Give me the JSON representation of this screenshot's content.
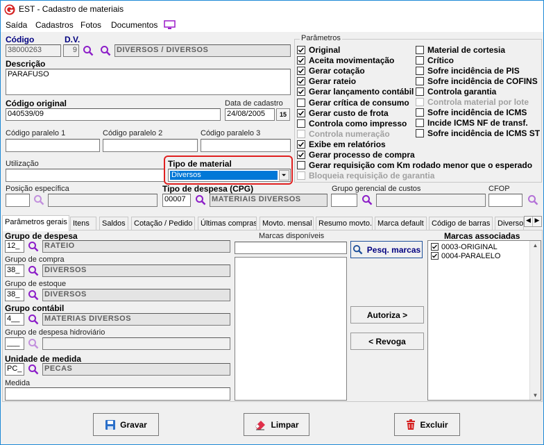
{
  "window": {
    "title": "EST - Cadastro de materiais"
  },
  "menu": {
    "items": [
      "Saída",
      "Cadastros",
      "Fotos",
      "Documentos"
    ]
  },
  "header": {
    "codigo_label": "Código",
    "codigo_value": "38000263",
    "dv_label": "D.V.",
    "dv_value": "9",
    "grupo_desc": "DIVERSOS / DIVERSOS",
    "descricao_label": "Descrição",
    "descricao_value": "PARAFUSO",
    "cod_original_label": "Código original",
    "cod_original_value": "040539/09",
    "data_cadastro_label": "Data de cadastro",
    "data_cadastro_value": "24/08/2005",
    "calendar_label": "15",
    "cod_paralelo1_label": "Código paralelo 1",
    "cod_paralelo2_label": "Código paralelo 2",
    "cod_paralelo3_label": "Código paralelo 3",
    "utilizacao_label": "Utilização",
    "tipo_material_label": "Tipo de material",
    "tipo_material_value": "Diversos",
    "posicao_label": "Posição específica",
    "tipo_despesa_label": "Tipo de despesa (CPG)",
    "tipo_despesa_code": "00007",
    "tipo_despesa_desc": "MATERIAIS DIVERSOS",
    "grupo_gerencial_label": "Grupo gerencial de custos",
    "cfop_label": "CFOP"
  },
  "parametros": {
    "title": "Parâmetros",
    "left": [
      {
        "label": "Original",
        "checked": true,
        "disabled": false
      },
      {
        "label": "Aceita movimentação",
        "checked": true,
        "disabled": false
      },
      {
        "label": "Gerar cotação",
        "checked": true,
        "disabled": false
      },
      {
        "label": "Gerar rateio",
        "checked": true,
        "disabled": false
      },
      {
        "label": "Gerar lançamento contábil",
        "checked": true,
        "disabled": false
      },
      {
        "label": "Gerar crítica de consumo",
        "checked": false,
        "disabled": false
      },
      {
        "label": "Gerar custo de frota",
        "checked": true,
        "disabled": false
      },
      {
        "label": "Controla como impresso",
        "checked": false,
        "disabled": false
      },
      {
        "label": "Controla numeração",
        "checked": false,
        "disabled": true
      },
      {
        "label": "Exibe em relatórios",
        "checked": true,
        "disabled": false
      },
      {
        "label": "Gerar processo de compra",
        "checked": true,
        "disabled": false
      },
      {
        "label": "Gerar requisição com Km rodado menor que o esperado",
        "checked": false,
        "disabled": false
      },
      {
        "label": "Bloqueia requisição de garantia",
        "checked": false,
        "disabled": true
      }
    ],
    "right": [
      {
        "label": "Material de cortesia",
        "checked": false,
        "disabled": false
      },
      {
        "label": "Crítico",
        "checked": false,
        "disabled": false
      },
      {
        "label": "Sofre incidência de PIS",
        "checked": false,
        "disabled": false
      },
      {
        "label": "Sofre incidência de COFINS",
        "checked": false,
        "disabled": false
      },
      {
        "label": "Controla garantia",
        "checked": false,
        "disabled": false
      },
      {
        "label": "Controla material por lote",
        "checked": false,
        "disabled": true
      },
      {
        "label": "Sofre incidência de ICMS",
        "checked": false,
        "disabled": false
      },
      {
        "label": "Incide ICMS NF de transf.",
        "checked": false,
        "disabled": false
      },
      {
        "label": "Sofre incidência de ICMS ST",
        "checked": false,
        "disabled": false
      }
    ]
  },
  "tabs": [
    "Parâmetros gerais",
    "Itens",
    "Saldos",
    "Cotação / Pedido",
    "Últimas compras",
    "Movto. mensal",
    "Resumo movto.",
    "Marca default",
    "Código de barras",
    "Diversos"
  ],
  "geral": {
    "grupo_despesa_label": "Grupo de despesa",
    "grupo_despesa_code": "12_",
    "grupo_despesa_desc": "RATEIO",
    "grupo_compra_label": "Grupo de compra",
    "grupo_compra_code": "38_",
    "grupo_compra_desc": "DIVERSOS",
    "grupo_estoque_label": "Grupo de estoque",
    "grupo_estoque_code": "38_",
    "grupo_estoque_desc": "DIVERSOS",
    "grupo_contabil_label": "Grupo contábil",
    "grupo_contabil_code": "4__",
    "grupo_contabil_desc": "MATERIAS DIVERSOS",
    "grupo_hidro_label": "Grupo de despesa hidroviário",
    "grupo_hidro_code": "___",
    "unidade_label": "Unidade de medida",
    "unidade_code": "PC_",
    "unidade_desc": "PECAS",
    "medida_label": "Medida",
    "marcas_disp_label": "Marcas disponíveis",
    "pesq_marcas": "Pesq. marcas",
    "autoriza": "Autoriza >",
    "revoga": "< Revoga",
    "marcas_assoc_label": "Marcas associadas",
    "marcas_assoc": [
      "0003-ORIGINAL",
      "0004-PARALELO"
    ]
  },
  "footer": {
    "gravar": "Gravar",
    "limpar": "Limpar",
    "excluir": "Excluir"
  },
  "colors": {
    "accent": "#1d89d6",
    "highlight_red": "#e02020",
    "select_blue": "#0078d7",
    "magnifier": "#8c1ec8"
  }
}
